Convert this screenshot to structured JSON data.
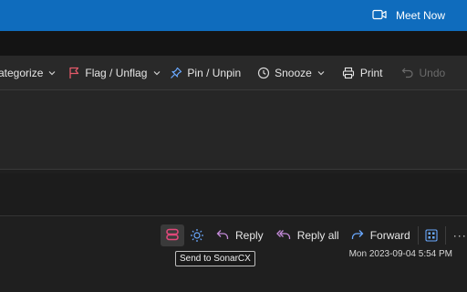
{
  "header": {
    "meet_now_label": "Meet Now",
    "meet_icon": "video-camera-icon",
    "accent_color": "#0f6cbd"
  },
  "ribbon": {
    "categorize_label": "ategorize",
    "flag_label": "Flag / Unflag",
    "pin_label": "Pin / Unpin",
    "snooze_label": "Snooze",
    "print_label": "Print",
    "undo_label": "Undo",
    "more_label": "···",
    "icons": {
      "flag": "flag-icon",
      "pin": "pin-icon",
      "snooze": "clock-icon",
      "print": "printer-icon",
      "undo": "undo-icon"
    }
  },
  "message_actions": {
    "sonar_tooltip": "Send to SonarCX",
    "reply_label": "Reply",
    "reply_all_label": "Reply all",
    "forward_label": "Forward",
    "more_label": "···",
    "date": "Mon 2023-09-04 5:54 PM",
    "icons": {
      "sonar": "sonarcx-icon",
      "addin": "sun-icon",
      "reply": "reply-icon",
      "reply_all": "reply-all-icon",
      "forward": "forward-icon",
      "apps": "apps-grid-icon"
    }
  }
}
